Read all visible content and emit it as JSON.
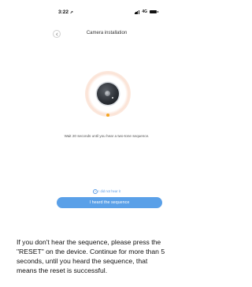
{
  "status_bar": {
    "time": "3:22",
    "location_arrow": "location-arrow-icon",
    "network": "4G"
  },
  "nav": {
    "title": "Camera installation",
    "back_icon": "chevron-left-icon"
  },
  "main": {
    "device_icon": "camera-device-icon",
    "instruction": "Wait 20 seconds until you hear a two-tone sequence.",
    "help_link": "I did not hear it",
    "primary_button": "I heard the sequence"
  },
  "caption": {
    "lines": [
      "If you don't hear the sequence, please press the",
      "\"RESET\" on the device. Continue for more than 5",
      "seconds, until you heard the sequence, that",
      "means the reset is successful."
    ]
  },
  "colors": {
    "accent": "#5aa0e8",
    "indicator": "#f5a623",
    "link": "#5a9be6"
  }
}
